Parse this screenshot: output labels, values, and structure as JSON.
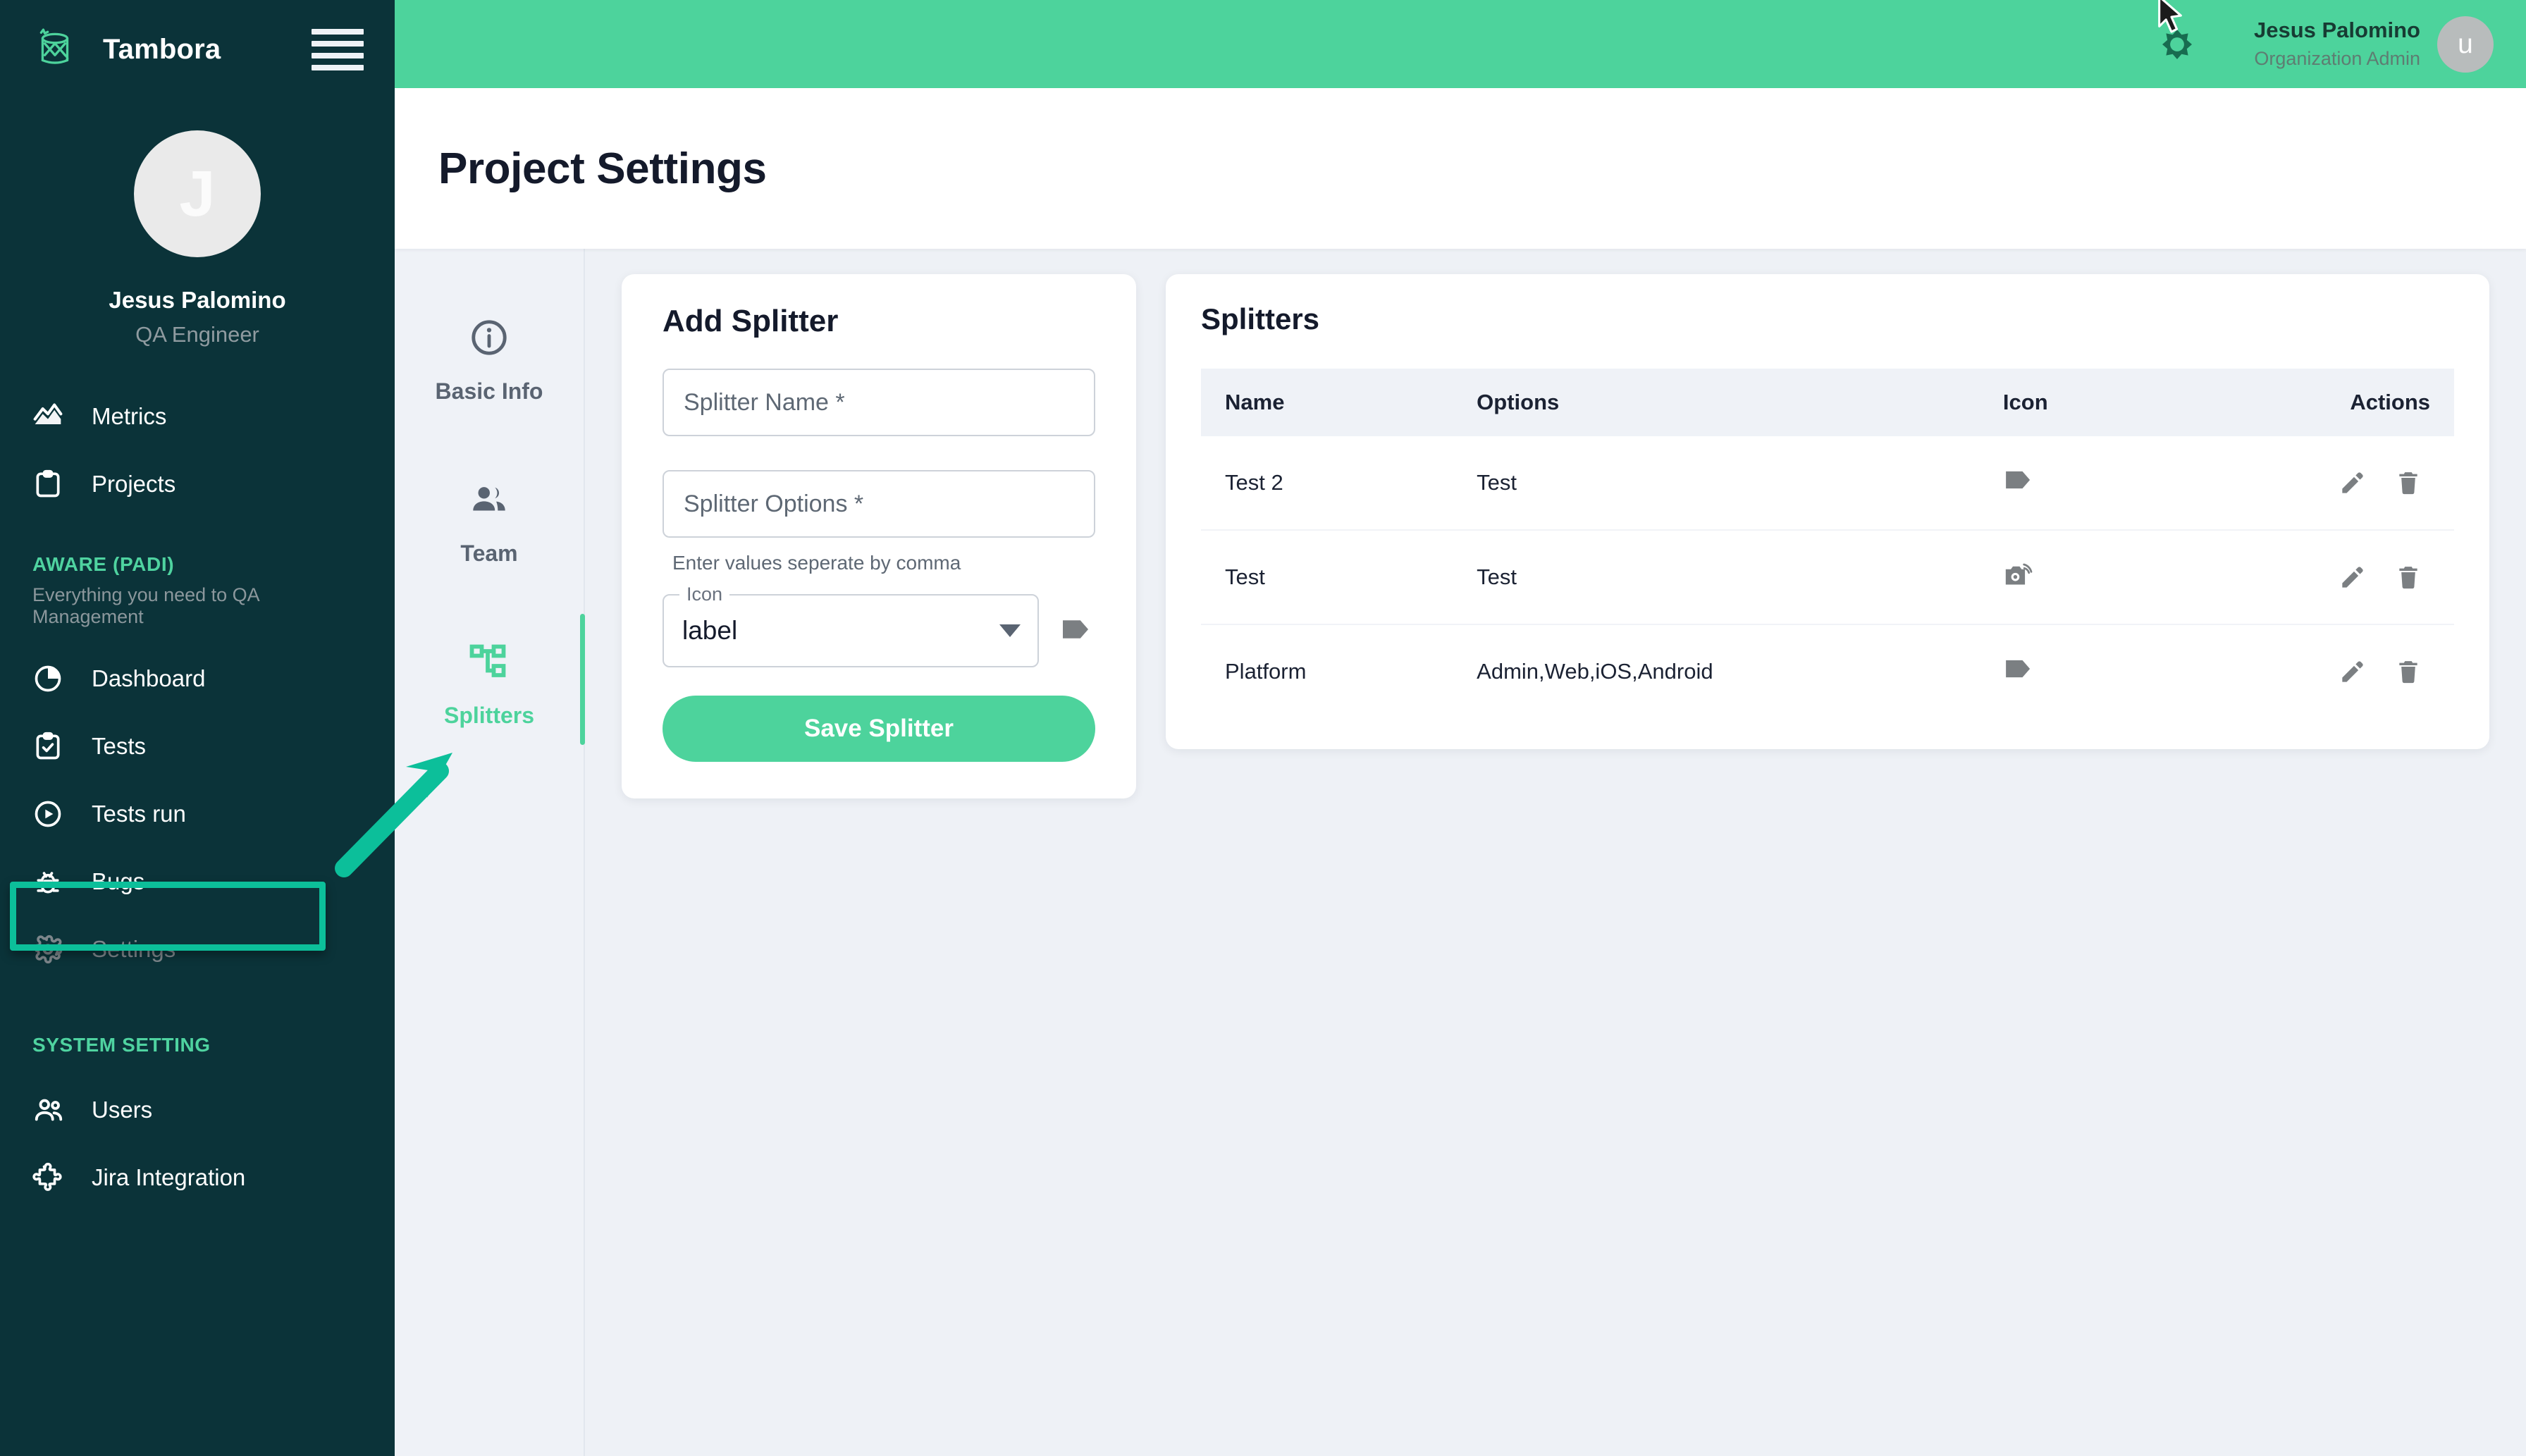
{
  "brand": {
    "name": "Tambora",
    "logo_icon": "drum-logo-icon",
    "menu_icon": "hamburger-menu-icon"
  },
  "sidebar": {
    "user": {
      "initial": "J",
      "name": "Jesus Palomino",
      "role": "QA Engineer"
    },
    "top_items": [
      {
        "label": "Metrics",
        "icon": "metrics-chart-icon"
      },
      {
        "label": "Projects",
        "icon": "clipboard-icon"
      }
    ],
    "group_aware": {
      "title": "AWARE (PADI)",
      "subtitle": "Everything you need to QA Management"
    },
    "aware_items": [
      {
        "label": "Dashboard",
        "icon": "pie-chart-icon"
      },
      {
        "label": "Tests",
        "icon": "clipboard-check-icon"
      },
      {
        "label": "Tests run",
        "icon": "play-circle-icon"
      },
      {
        "label": "Bugs",
        "icon": "bug-icon"
      },
      {
        "label": "Settings",
        "icon": "gear-icon"
      }
    ],
    "group_system": {
      "title": "SYSTEM SETTING"
    },
    "system_items": [
      {
        "label": "Users",
        "icon": "users-group-icon"
      },
      {
        "label": "Jira Integration",
        "icon": "puzzle-piece-icon"
      }
    ]
  },
  "topbar": {
    "gear_icon": "gear-sun-icon",
    "user_name": "Jesus Palomino",
    "user_role": "Organization Admin",
    "avatar_initial": "u"
  },
  "page": {
    "title": "Project Settings"
  },
  "tabs": [
    {
      "label": "Basic Info",
      "icon": "info-circle-icon",
      "active": false
    },
    {
      "label": "Team",
      "icon": "people-icon",
      "active": false
    },
    {
      "label": "Splitters",
      "icon": "sitemap-icon",
      "active": true
    }
  ],
  "add_splitter": {
    "title": "Add Splitter",
    "name_placeholder": "Splitter Name *",
    "name_value": "",
    "options_placeholder": "Splitter Options *",
    "options_value": "",
    "hint": "Enter values seperate by comma",
    "icon_label": "Icon",
    "icon_value": "label",
    "icon_preview": "tag-label-icon",
    "save_label": "Save Splitter"
  },
  "splitters_panel": {
    "title": "Splitters",
    "columns": [
      "Name",
      "Options",
      "Icon",
      "Actions"
    ],
    "rows": [
      {
        "name": "Test 2",
        "options": "Test",
        "icon": "tag-label-icon",
        "edit": "edit-pencil-icon",
        "delete": "trash-icon"
      },
      {
        "name": "Test",
        "options": "Test",
        "icon": "camera-wifi-icon",
        "edit": "edit-pencil-icon",
        "delete": "trash-icon"
      },
      {
        "name": "Platform",
        "options": "Admin,Web,iOS,Android",
        "icon": "tag-label-icon",
        "edit": "edit-pencil-icon",
        "delete": "trash-icon"
      }
    ]
  },
  "annotations": {
    "highlight_target": "Settings",
    "arrow_target": "Splitters",
    "highlight_color": "#0cbf9a",
    "arrow_color": "#0cbf9a"
  },
  "colors": {
    "sidebar_bg": "#0b3339",
    "accent_green": "#4dd39c",
    "page_bg": "#eef1f6",
    "text_dark": "#141a2b"
  }
}
